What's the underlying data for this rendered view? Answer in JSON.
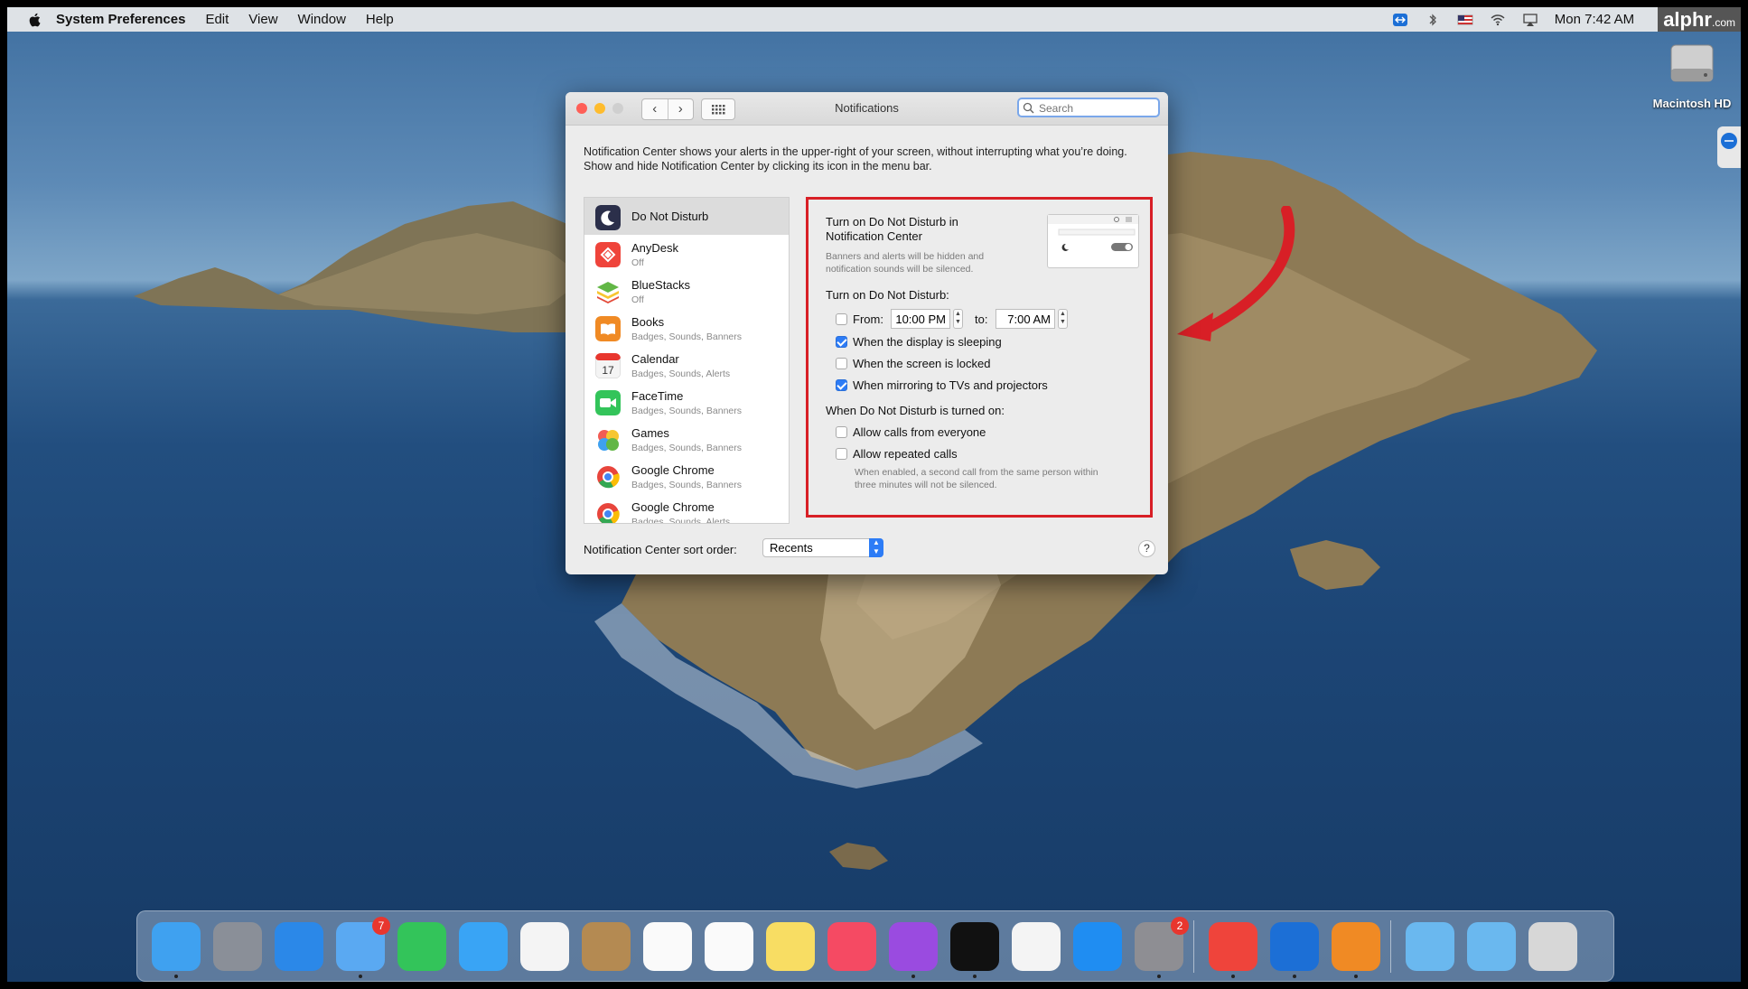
{
  "watermark_top": "alphr.com",
  "menubar": {
    "app_name": "System Preferences",
    "items": [
      "Edit",
      "View",
      "Window",
      "Help"
    ],
    "clock": "Mon 7:42 AM",
    "logo": "alphr",
    "logo_suffix": ".com"
  },
  "desktop": {
    "drive_label": "Macintosh HD"
  },
  "window": {
    "title": "Notifications",
    "search_placeholder": "Search",
    "description": "Notification Center shows your alerts in the upper-right of your screen, without interrupting what you’re doing. Show and hide Notification Center by clicking its icon in the menu bar.",
    "apps": [
      {
        "name": "Do Not Disturb",
        "sub": "",
        "icon": "moon-icon",
        "color": "#2b2f4a"
      },
      {
        "name": "AnyDesk",
        "sub": "Off",
        "icon": "anydesk-icon",
        "color": "#ef443b"
      },
      {
        "name": "BlueStacks",
        "sub": "Off",
        "icon": "bluestacks-icon",
        "color": "#62b746"
      },
      {
        "name": "Books",
        "sub": "Badges, Sounds, Banners",
        "icon": "books-icon",
        "color": "#f08a24"
      },
      {
        "name": "Calendar",
        "sub": "Badges, Sounds, Alerts",
        "icon": "calendar-icon",
        "color": "#f4f4f4"
      },
      {
        "name": "FaceTime",
        "sub": "Badges, Sounds, Banners",
        "icon": "facetime-icon",
        "color": "#33c45a"
      },
      {
        "name": "Games",
        "sub": "Badges, Sounds, Banners",
        "icon": "games-icon",
        "color": "#7b66e0"
      },
      {
        "name": "Google Chrome",
        "sub": "Badges, Sounds, Banners",
        "icon": "chrome-icon",
        "color": "#f2f2f2"
      },
      {
        "name": "Google Chrome",
        "sub": "Badges, Sounds, Alerts",
        "icon": "chrome-icon",
        "color": "#f2f2f2"
      }
    ],
    "dnd": {
      "nc_title_line1": "Turn on Do Not Disturb in",
      "nc_title_line2": "Notification Center",
      "nc_desc_line1": "Banners and alerts will be hidden and",
      "nc_desc_line2": "notification sounds will be silenced.",
      "turn_on_heading": "Turn on Do Not Disturb:",
      "from_label": "From:",
      "from_value": "10:00 PM",
      "to_label": "to:",
      "to_value": "7:00 AM",
      "from_checked": false,
      "opt_sleeping": "When the display is sleeping",
      "opt_sleeping_checked": true,
      "opt_locked": "When the screen is locked",
      "opt_locked_checked": false,
      "opt_mirroring": "When mirroring to TVs and projectors",
      "opt_mirroring_checked": true,
      "when_on_heading": "When Do Not Disturb is turned on:",
      "opt_calls_everyone": "Allow calls from everyone",
      "opt_calls_everyone_checked": false,
      "opt_repeated": "Allow repeated calls",
      "opt_repeated_checked": false,
      "repeated_note_line1": "When enabled, a second call from the same person within",
      "repeated_note_line2": "three minutes will not be silenced."
    },
    "sort_label": "Notification Center sort order:",
    "sort_value": "Recents",
    "help": "?"
  },
  "dock": {
    "apps": [
      {
        "name": "finder-icon",
        "color": "#3fa1f0",
        "badge": ""
      },
      {
        "name": "launchpad-icon",
        "color": "#8a8f98",
        "badge": ""
      },
      {
        "name": "safari-icon",
        "color": "#2b88e8",
        "badge": ""
      },
      {
        "name": "mail-icon",
        "color": "#5aa9f2",
        "badge": "7"
      },
      {
        "name": "facetime-icon",
        "color": "#33c45a",
        "badge": ""
      },
      {
        "name": "messages-icon",
        "color": "#39a4f5",
        "badge": ""
      },
      {
        "name": "photos-icon",
        "color": "#f4f4f4",
        "badge": ""
      },
      {
        "name": "contacts-icon",
        "color": "#b48a52",
        "badge": ""
      },
      {
        "name": "calendar-icon",
        "color": "#fafafa",
        "badge": ""
      },
      {
        "name": "reminders-icon",
        "color": "#fafafa",
        "badge": ""
      },
      {
        "name": "notes-icon",
        "color": "#f8dd63",
        "badge": ""
      },
      {
        "name": "music-icon",
        "color": "#f54a63",
        "badge": ""
      },
      {
        "name": "podcasts-icon",
        "color": "#9a4be0",
        "badge": ""
      },
      {
        "name": "apple-tv-icon",
        "color": "#111111",
        "badge": ""
      },
      {
        "name": "news-icon",
        "color": "#f4f4f4",
        "badge": ""
      },
      {
        "name": "app-store-icon",
        "color": "#1f8df2",
        "badge": ""
      },
      {
        "name": "system-preferences-icon",
        "color": "#8e8e93",
        "badge": "2"
      },
      {
        "name": "anydesk-icon",
        "color": "#ef443b",
        "badge": ""
      },
      {
        "name": "teamviewer-icon",
        "color": "#1c6fd6",
        "badge": ""
      },
      {
        "name": "vlc-icon",
        "color": "#f08a24",
        "badge": ""
      },
      {
        "name": "documents-folder-icon",
        "color": "#6ab8ef",
        "badge": ""
      },
      {
        "name": "downloads-folder-icon",
        "color": "#6ab8ef",
        "badge": ""
      },
      {
        "name": "trash-icon",
        "color": "#d7d7d7",
        "badge": ""
      }
    ]
  },
  "colors": {
    "highlight": "#d81f26",
    "accent": "#2d7cf6"
  }
}
